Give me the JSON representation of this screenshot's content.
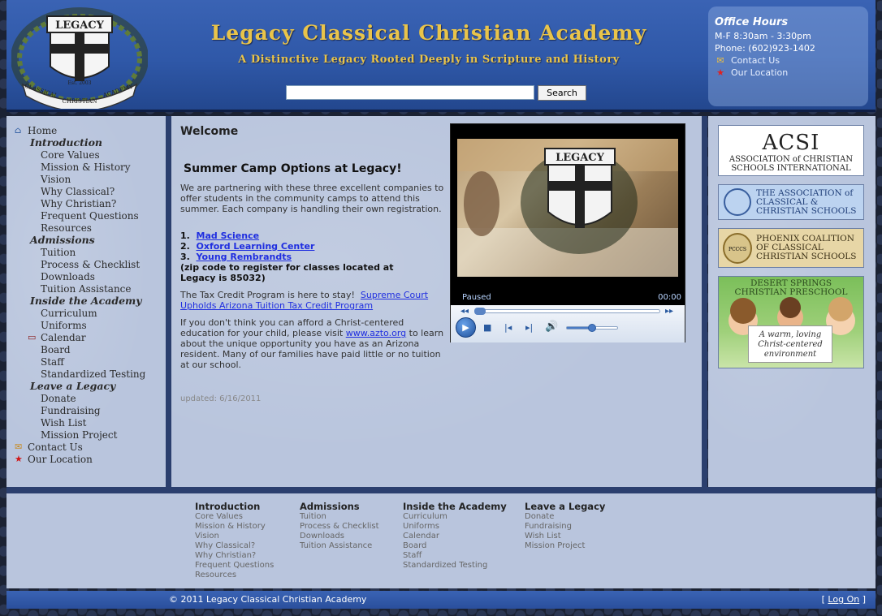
{
  "header": {
    "title": "Legacy Classical Christian Academy",
    "tagline": "A Distinctive Legacy Rooted Deeply in Scripture and History",
    "search_button": "Search",
    "office_hours": {
      "title": "Office Hours",
      "hours": "M-F 8:30am - 3:30pm",
      "phone": "Phone: (602)923-1402",
      "contact": "Contact Us",
      "location": "Our Location"
    }
  },
  "nav": {
    "home": "Home",
    "groups": [
      {
        "heading": "Introduction",
        "items": [
          "Core Values",
          "Mission & History",
          "Vision",
          "Why Classical?",
          "Why Christian?",
          "Frequent Questions",
          "Resources"
        ]
      },
      {
        "heading": "Admissions",
        "items": [
          "Tuition",
          "Process & Checklist",
          "Downloads",
          "Tuition Assistance"
        ]
      },
      {
        "heading": "Inside the Academy",
        "items": [
          "Curriculum",
          "Uniforms",
          "Calendar",
          "Board",
          "Staff",
          "Standardized Testing"
        ]
      },
      {
        "heading": "Leave a Legacy",
        "items": [
          "Donate",
          "Fundraising",
          "Wish List",
          "Mission Project"
        ]
      }
    ],
    "contact": "Contact Us",
    "location": "Our Location"
  },
  "main": {
    "welcome": "Welcome",
    "camp_title": "Summer Camp Options at Legacy!",
    "intro": "We are partnering with these three excellent companies to offer students in the community camps to attend this summer. Each company is handling their own registration.",
    "camps": [
      "Mad Science",
      "Oxford Learning Center",
      "Young Rembrandts"
    ],
    "zip_note": "(zip code to register for classes located at Legacy is 85032)",
    "tax_prefix": "The Tax Credit Program is here to stay!",
    "tax_link": "Supreme Court Upholds Arizona Tuition Tax Credit Program",
    "afford_prefix": "If you don't think you can afford a Christ-centered education for your child, please visit",
    "afford_link": "www.azto.org",
    "afford_suffix": "to learn about the unique opportunity you have as an Arizona resident. Many of our families have paid little or no tuition at our school.",
    "updated": "updated: 6/16/2011",
    "video": {
      "status": "Paused",
      "time": "00:00",
      "volume_pct": 50,
      "logo_text": "LEGACY"
    }
  },
  "banners": {
    "acsi": {
      "big": "ACSI",
      "line1": "ASSOCIATION of CHRISTIAN",
      "line2": "SCHOOLS INTERNATIONAL"
    },
    "accs": {
      "line1": "THE ASSOCIATION of",
      "line2": "CLASSICAL &",
      "line3": "CHRISTIAN SCHOOLS"
    },
    "pccs": {
      "seal": "PCCCS",
      "line1": "PHOENIX COALITION",
      "line2": "OF CLASSICAL",
      "line3": "CHRISTIAN SCHOOLS"
    },
    "desert": {
      "line1": "DESERT SPRINGS",
      "line2": "CHRISTIAN PRESCHOOL",
      "card1": "A warm, loving",
      "card2": "Christ-centered",
      "card3": "environment"
    }
  },
  "footer": {
    "columns": [
      {
        "heading": "Introduction",
        "items": [
          "Core Values",
          "Mission & History",
          "Vision",
          "Why Classical?",
          "Why Christian?",
          "Frequent Questions",
          "Resources"
        ]
      },
      {
        "heading": "Admissions",
        "items": [
          "Tuition",
          "Process & Checklist",
          "Downloads",
          "Tuition Assistance"
        ]
      },
      {
        "heading": "Inside the Academy",
        "items": [
          "Curriculum",
          "Uniforms",
          "Calendar",
          "Board",
          "Staff",
          "Standardized Testing"
        ]
      },
      {
        "heading": "Leave a Legacy",
        "items": [
          "Donate",
          "Fundraising",
          "Wish List",
          "Mission Project"
        ]
      }
    ],
    "copyright": "© 2011 Legacy Classical Christian Academy",
    "login_open": "[",
    "login": "Log On",
    "login_close": "]"
  },
  "logo": {
    "top": "LEGACY",
    "ring_left": "CLASSICAL",
    "ring_mid": "CHRISTIAN",
    "ring_right": "ACADEMY",
    "est": "Est. 2003"
  },
  "colors": {
    "header_blue": "#2f58a8",
    "gold": "#e9c44a",
    "link": "#1f2ee0",
    "panel": "#b9c5dd"
  }
}
